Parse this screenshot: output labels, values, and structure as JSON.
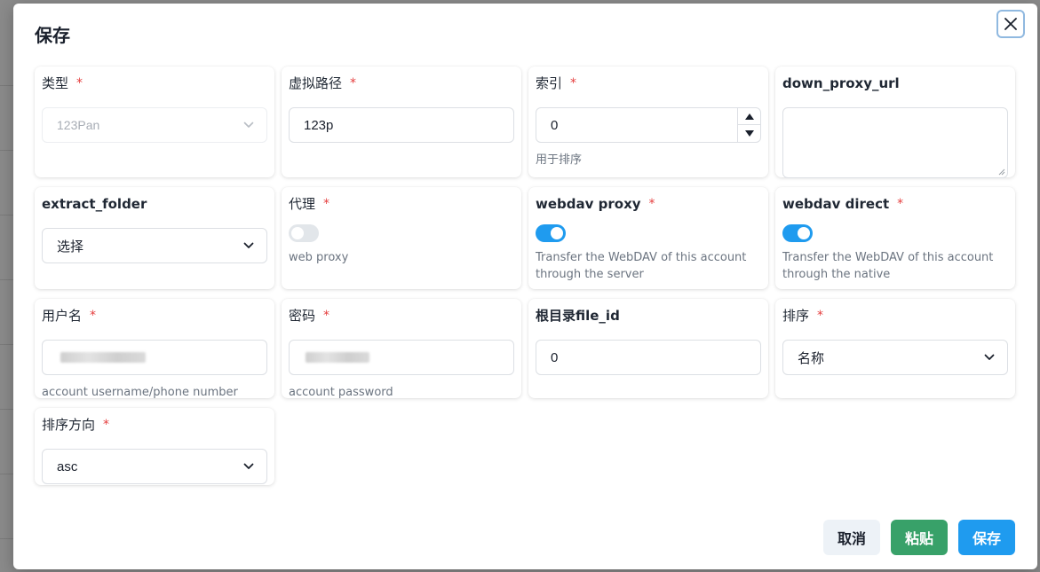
{
  "dialog": {
    "title": "保存",
    "close_icon": "close-icon"
  },
  "fields": {
    "type": {
      "label": "类型",
      "required": "*",
      "value": "123Pan",
      "disabled": true
    },
    "virtual_path": {
      "label": "虚拟路径",
      "required": "*",
      "value": "123p"
    },
    "index": {
      "label": "索引",
      "required": "*",
      "value": "0",
      "helper": "用于排序"
    },
    "down_proxy_url": {
      "label": "down_proxy_url",
      "value": ""
    },
    "extract_folder": {
      "label": "extract_folder",
      "value": "选择"
    },
    "proxy": {
      "label": "代理",
      "required": "*",
      "checked": false,
      "helper": "web proxy"
    },
    "webdav_proxy": {
      "label": "webdav proxy",
      "required": "*",
      "checked": true,
      "helper": "Transfer the WebDAV of this account through the server"
    },
    "webdav_direct": {
      "label": "webdav direct",
      "required": "*",
      "checked": true,
      "helper": "Transfer the WebDAV of this account through the native"
    },
    "username": {
      "label": "用户名",
      "required": "*",
      "value": "",
      "helper": "account username/phone number"
    },
    "password": {
      "label": "密码",
      "required": "*",
      "value": "",
      "helper": "account password"
    },
    "root_folder_file_id": {
      "label": "根目录file_id",
      "value": "0"
    },
    "order_by": {
      "label": "排序",
      "required": "*",
      "value": "名称"
    },
    "order_direction": {
      "label": "排序方向",
      "required": "*",
      "value": "asc"
    }
  },
  "buttons": {
    "cancel": "取消",
    "paste": "粘贴",
    "save": "保存"
  },
  "colors": {
    "primary": "#1f9bef",
    "success": "#38a169",
    "required": "#e53e3e",
    "toggle_off": "#e2e6ea"
  }
}
